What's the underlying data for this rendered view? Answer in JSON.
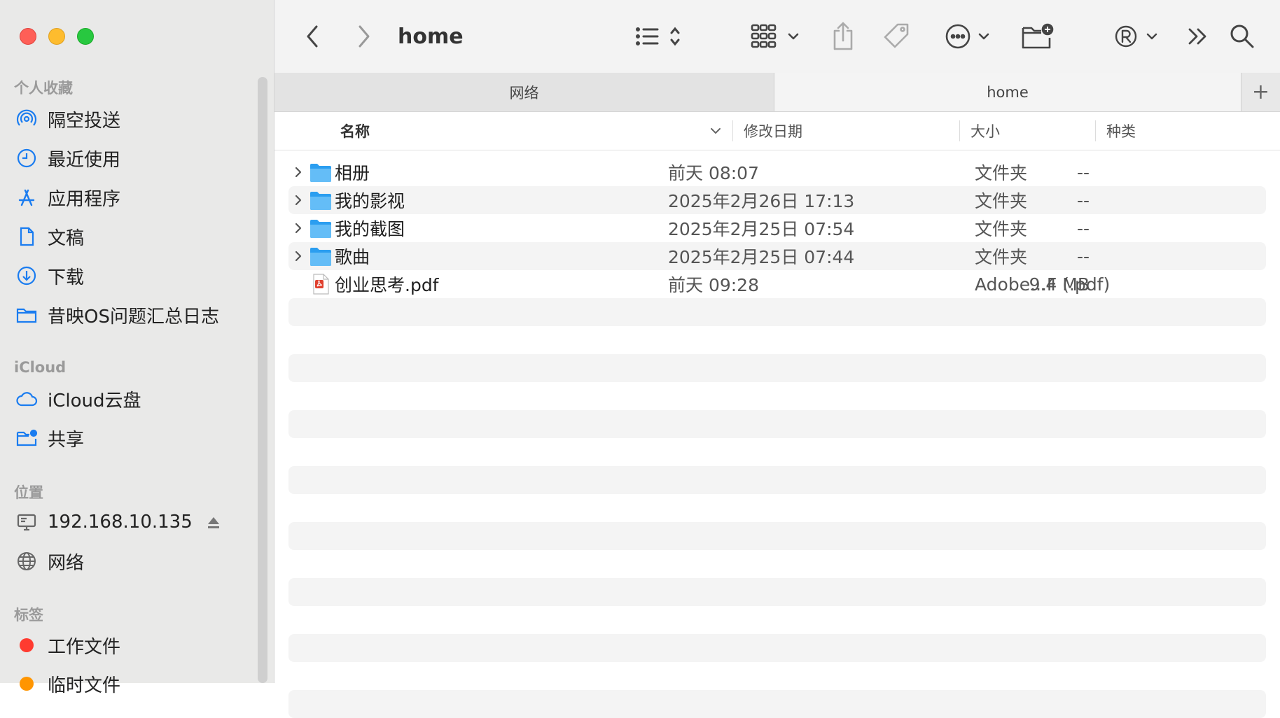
{
  "sidebar": {
    "favorites_header": "个人收藏",
    "favorites": [
      {
        "label": "隔空投送",
        "icon": "airdrop-icon"
      },
      {
        "label": "最近使用",
        "icon": "clock-icon"
      },
      {
        "label": "应用程序",
        "icon": "applications-icon"
      },
      {
        "label": "文稿",
        "icon": "document-icon"
      },
      {
        "label": "下载",
        "icon": "download-icon"
      },
      {
        "label": "昔映OS问题汇总日志",
        "icon": "folder-icon"
      }
    ],
    "icloud_header": "iCloud",
    "icloud": [
      {
        "label": "iCloud云盘",
        "icon": "cloud-icon"
      },
      {
        "label": "共享",
        "icon": "shared-folder-icon"
      }
    ],
    "locations_header": "位置",
    "locations": [
      {
        "label": "192.168.10.135",
        "icon": "computer-icon"
      },
      {
        "label": "网络",
        "icon": "globe-icon"
      }
    ],
    "tags_header": "标签",
    "tags": [
      {
        "label": "工作文件",
        "color": "#ff3b30"
      },
      {
        "label": "临时文件",
        "color": "#ff9500"
      }
    ]
  },
  "toolbar": {
    "title": "home"
  },
  "tabs": [
    {
      "label": "网络"
    },
    {
      "label": "home"
    }
  ],
  "tab_add_label": "+",
  "columns": {
    "name": "名称",
    "date": "修改日期",
    "size": "大小",
    "kind": "种类"
  },
  "files": [
    {
      "name": "相册",
      "date": "前天 08:07",
      "size": "--",
      "kind": "文件夹",
      "type": "folder"
    },
    {
      "name": "我的影视",
      "date": "2025年2月26日 17:13",
      "size": "--",
      "kind": "文件夹",
      "type": "folder"
    },
    {
      "name": "我的截图",
      "date": "2025年2月25日 07:54",
      "size": "--",
      "kind": "文件夹",
      "type": "folder"
    },
    {
      "name": "歌曲",
      "date": "2025年2月25日 07:44",
      "size": "--",
      "kind": "文件夹",
      "type": "folder"
    },
    {
      "name": "创业思考.pdf",
      "date": "前天 09:28",
      "size": "9.4 MB",
      "kind": "Adobe...F (.pdf)",
      "type": "pdf"
    }
  ]
}
